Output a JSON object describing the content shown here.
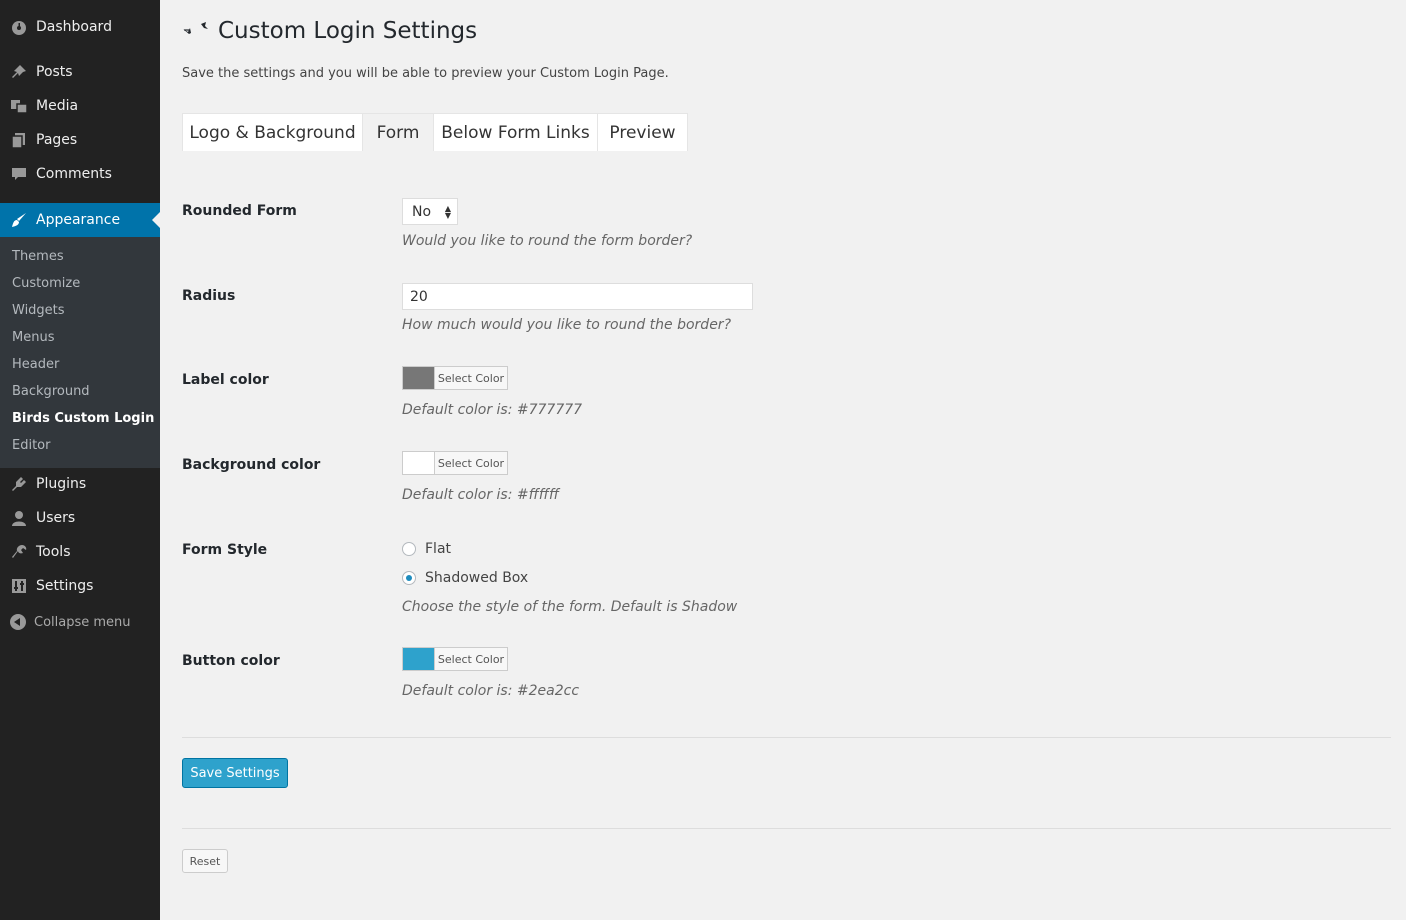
{
  "sidebar": {
    "top_items": [
      {
        "label": "Dashboard",
        "icon": "dashboard-icon"
      },
      {
        "label": "Posts",
        "icon": "pin-icon"
      },
      {
        "label": "Media",
        "icon": "media-icon"
      },
      {
        "label": "Pages",
        "icon": "pages-icon"
      },
      {
        "label": "Comments",
        "icon": "comment-icon"
      }
    ],
    "active_item": {
      "label": "Appearance",
      "icon": "paintbrush-icon"
    },
    "submenu": [
      "Themes",
      "Customize",
      "Widgets",
      "Menus",
      "Header",
      "Background",
      "Birds Custom Login",
      "Editor"
    ],
    "bottom_items": [
      {
        "label": "Plugins",
        "icon": "plugin-icon"
      },
      {
        "label": "Users",
        "icon": "user-icon"
      },
      {
        "label": "Tools",
        "icon": "wrench-icon"
      },
      {
        "label": "Settings",
        "icon": "settings-icon"
      }
    ],
    "collapse_label": "Collapse menu"
  },
  "page": {
    "title": "Custom Login Settings",
    "subtitle": "Save the settings and you will be able to preview your Custom Login Page."
  },
  "tabs": [
    "Logo & Background",
    "Form",
    "Below Form Links",
    "Preview"
  ],
  "active_tab": "Form",
  "form": {
    "rounded": {
      "label": "Rounded Form",
      "value": "No",
      "desc": "Would you like to round the form border?"
    },
    "radius": {
      "label": "Radius",
      "value": "20",
      "desc": "How much would you like to round the border?"
    },
    "label_color": {
      "label": "Label color",
      "button": "Select Color",
      "swatch": "#777777",
      "desc": "Default color is: #777777"
    },
    "background_color": {
      "label": "Background color",
      "button": "Select Color",
      "swatch": "#ffffff",
      "desc": "Default color is: #ffffff"
    },
    "form_style": {
      "label": "Form Style",
      "options": [
        "Flat",
        "Shadowed Box"
      ],
      "selected": "Shadowed Box",
      "desc": "Choose the style of the form. Default is Shadow"
    },
    "button_color": {
      "label": "Button color",
      "button": "Select Color",
      "swatch": "#2ea2cc",
      "desc": "Default color is: #2ea2cc"
    }
  },
  "buttons": {
    "save": "Save Settings",
    "reset": "Reset"
  },
  "colors": {
    "accent": "#0073aa",
    "sidebar_bg": "#222222",
    "submenu_bg": "#32373c",
    "save_button": "#2ea2cc"
  }
}
